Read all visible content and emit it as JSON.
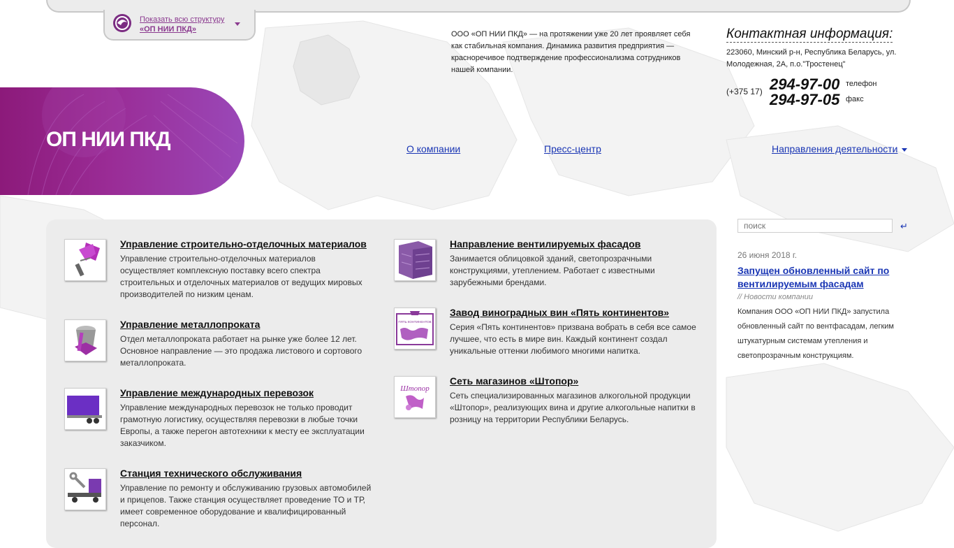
{
  "structure": {
    "line1": "Показать всю структуру",
    "line2": "«ОП НИИ ПКД»"
  },
  "about": {
    "text": "ООО «ОП НИИ ПКД» — на протяжении уже 20 лет проявляет себя как стабильная компания. Динамика развития предприятия — красноречивое подтверждение профессионализма сотрудников нашей компании."
  },
  "contacts": {
    "title": "Контактная информация:",
    "address": "223060, Минский р-н, Республика Беларусь, ул. Молодежная, 2А, п.о.\"Тростенец\"",
    "code": "(+375 17)",
    "phone": "294-97-00",
    "phone_label": "телефон",
    "fax": "294-97-05",
    "fax_label": "факс"
  },
  "brand": {
    "name": "ОП НИИ ПКД"
  },
  "nav": {
    "about": "О компании",
    "press": "Пресс-центр",
    "directions": "Направления деятельности"
  },
  "items": [
    {
      "title": "Управление строительно-отделочных материалов",
      "desc": "Управление строительно-отделочных материалов осуществляет комплексную поставку всего спектра строительных и отделочных материалов от ведущих мировых производителей по низким ценам.",
      "icon": "paint-roller-icon"
    },
    {
      "title": "Управление металлопроката",
      "desc": "Отдел металлопроката работает на рынке уже более 12 лет. Основное направление — это продажа листового и сортового металлопроката.",
      "icon": "paint-bucket-icon"
    },
    {
      "title": "Управление международных перевозок",
      "desc": "Управление международных перевозок не только проводит грамотную логистику, осуществляя перевозки в любые точки Европы, а также перегон автотехники к месту ее эксплуатации заказчиком.",
      "icon": "truck-icon"
    },
    {
      "title": "Станция технического обслуживания",
      "desc": "Управление по ремонту и обслуживанию грузовых автомобилей и прицепов. Также станция осуществляет проведение ТО и ТР, имеет современное оборудование и квалифицированный персонал.",
      "icon": "wrench-truck-icon"
    },
    {
      "title": "Направление вентилируемых фасадов",
      "desc": "Занимается облицовкой зданий, светопрозрачными конструкциями, утеплением. Работает с известными зарубежными брендами.",
      "icon": "facade-icon"
    },
    {
      "title": "Завод виноградных вин «Пять континентов»",
      "desc": "Серия «Пять континентов» призвана вобрать в себя все самое лучшее, что есть в мире вин. Каждый континент создал уникальные оттенки любимого многими напитка.",
      "icon": "wine-label-icon",
      "label_text": "ПЯТЬ КОНТИНЕНТОВ"
    },
    {
      "title": "Сеть магазинов «Штопор»",
      "desc": "Сеть специализированных магазинов алкогольной продукции «Штопор», реализующих вина и другие алкогольные напитки в розницу на территории Республики Беларусь.",
      "icon": "shtopor-logo-icon",
      "label_text": "Штопор"
    }
  ],
  "search": {
    "placeholder": "поиск",
    "go": "↵"
  },
  "news": {
    "date": "26 июня 2018 г.",
    "headline": "Запущен обновленный сайт по вентилируемым фасадам",
    "category": "// Новости компании",
    "body": "Компания ООО «ОП НИИ ПКД» запустила обновленный сайт по вентфасадам, легким штукатурным системам утепления и светопрозрачным конструкциям."
  },
  "colors": {
    "brand_purple": "#8c1a7a",
    "link_blue": "#1a36b4",
    "panel_gray": "#ececec"
  }
}
